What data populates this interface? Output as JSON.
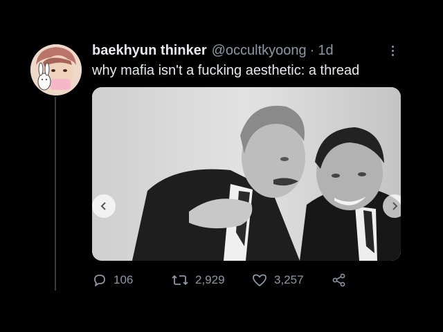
{
  "tweet": {
    "display_name": "baekhyun thinker",
    "handle": "@occultkyoong",
    "separator": "·",
    "time": "1d",
    "text": "why mafia isn't a fucking aesthetic: a thread"
  },
  "actions": {
    "replies": "106",
    "retweets": "2,929",
    "likes": "3,257"
  },
  "icons": {
    "more": "more-options-icon",
    "reply": "reply-icon",
    "retweet": "retweet-icon",
    "like": "heart-icon",
    "share": "share-icon",
    "prev": "chevron-left-icon",
    "next": "chevron-right-icon"
  },
  "colors": {
    "background": "#000000",
    "primary_text": "#e7e9ea",
    "secondary_text": "#8b98a5",
    "thread_line": "#3a3d42"
  }
}
